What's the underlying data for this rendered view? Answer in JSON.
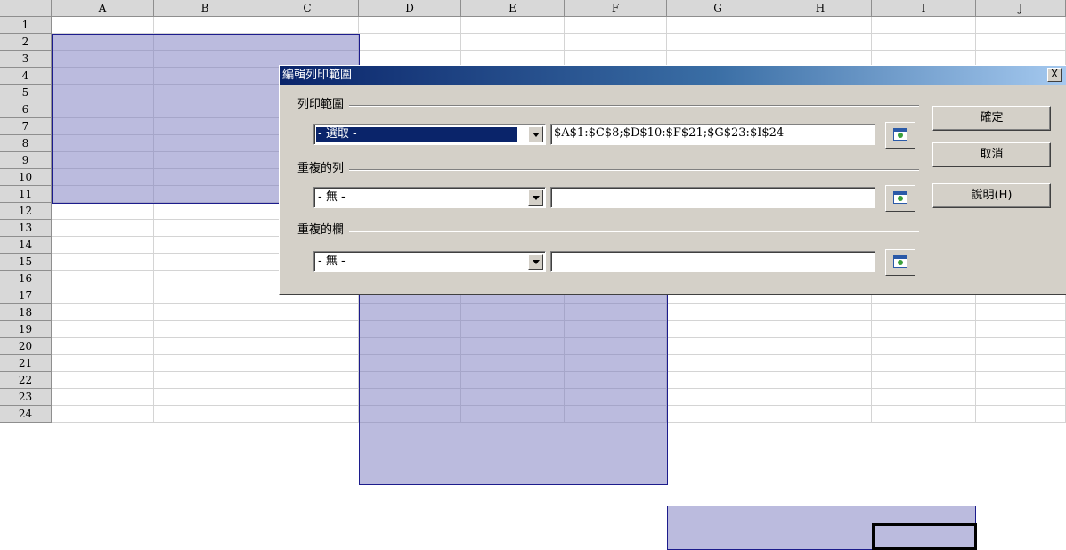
{
  "sheet": {
    "columns": [
      "A",
      "B",
      "C",
      "D",
      "E",
      "F",
      "G",
      "H",
      "I",
      "J"
    ],
    "rows": [
      "1",
      "2",
      "3",
      "4",
      "5",
      "6",
      "7",
      "8",
      "9",
      "10",
      "11",
      "12",
      "13",
      "14",
      "15",
      "16",
      "17",
      "18",
      "19",
      "20",
      "21",
      "22",
      "23",
      "24"
    ],
    "selection_color": "#7878be",
    "active_cell": "I24"
  },
  "dialog": {
    "title": "編輯列印範圍",
    "close_label": "X",
    "print_range": {
      "label": "列印範圍",
      "combo_value": "- 選取 -",
      "field_value": "$A$1:$C$8;$D$10:$F$21;$G$23:$I$24"
    },
    "repeat_rows": {
      "label": "重複的列",
      "combo_value": "- 無 -",
      "field_value": ""
    },
    "repeat_columns": {
      "label": "重複的欄",
      "combo_value": "- 無 -",
      "field_value": ""
    },
    "buttons": {
      "ok": "確定",
      "cancel": "取消",
      "help": "說明(H)"
    }
  }
}
